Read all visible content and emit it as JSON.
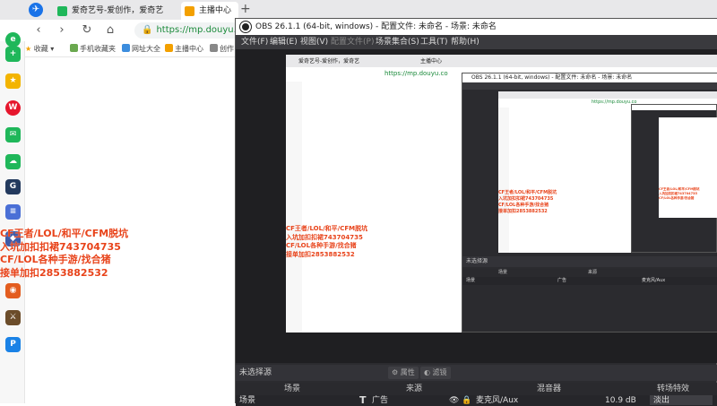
{
  "browser": {
    "tabs": [
      {
        "label": "爱奇艺号-爱创作，爱奇艺",
        "color": "#1fb75a"
      },
      {
        "label": "主播中心",
        "color": "#f3a000"
      }
    ],
    "url": "https://mp.douyu.com",
    "url_display": "https://mp.douyu.co",
    "bookmarks": [
      "收藏",
      "手机收藏夹",
      "网址大全",
      "主播中心",
      "创作"
    ],
    "sidebar_icons": [
      "browser-icon",
      "plus-icon",
      "star-icon",
      "weibo-icon",
      "mail-icon",
      "cloud-icon",
      "game-icon",
      "doc-icon",
      "game2-icon",
      "game3-icon",
      "game4-icon",
      "pdf-icon"
    ]
  },
  "promo": {
    "line1": "CF王者/LOL/和平/CFM脱坑",
    "line2": "入坑加扣扣裙743704735",
    "line3": "CF/LOL各种手游/找合猪",
    "line4": "接单加扣2853882532"
  },
  "obs": {
    "title": "OBS 26.1.1 (64-bit, windows) - 配置文件: 未命名 - 场景: 未命名",
    "menu": [
      "文件(F)",
      "编辑(E)",
      "视图(V)",
      "配置文件(P)",
      "场景集合(S)",
      "工具(T)",
      "帮助(H)"
    ],
    "menu_disabled_index": 3,
    "no_source_selected": "未选择源",
    "properties_label": "属性",
    "filters_label": "滤镜",
    "columns": {
      "scenes": "场景",
      "sources": "来源",
      "mixer": "混音器",
      "transitions": "转场特效"
    },
    "row": {
      "scene": "场景",
      "source": "广告",
      "mixer_device": "麦克风/Aux",
      "mixer_level": "10.9 dB",
      "transition": "淡出"
    }
  }
}
